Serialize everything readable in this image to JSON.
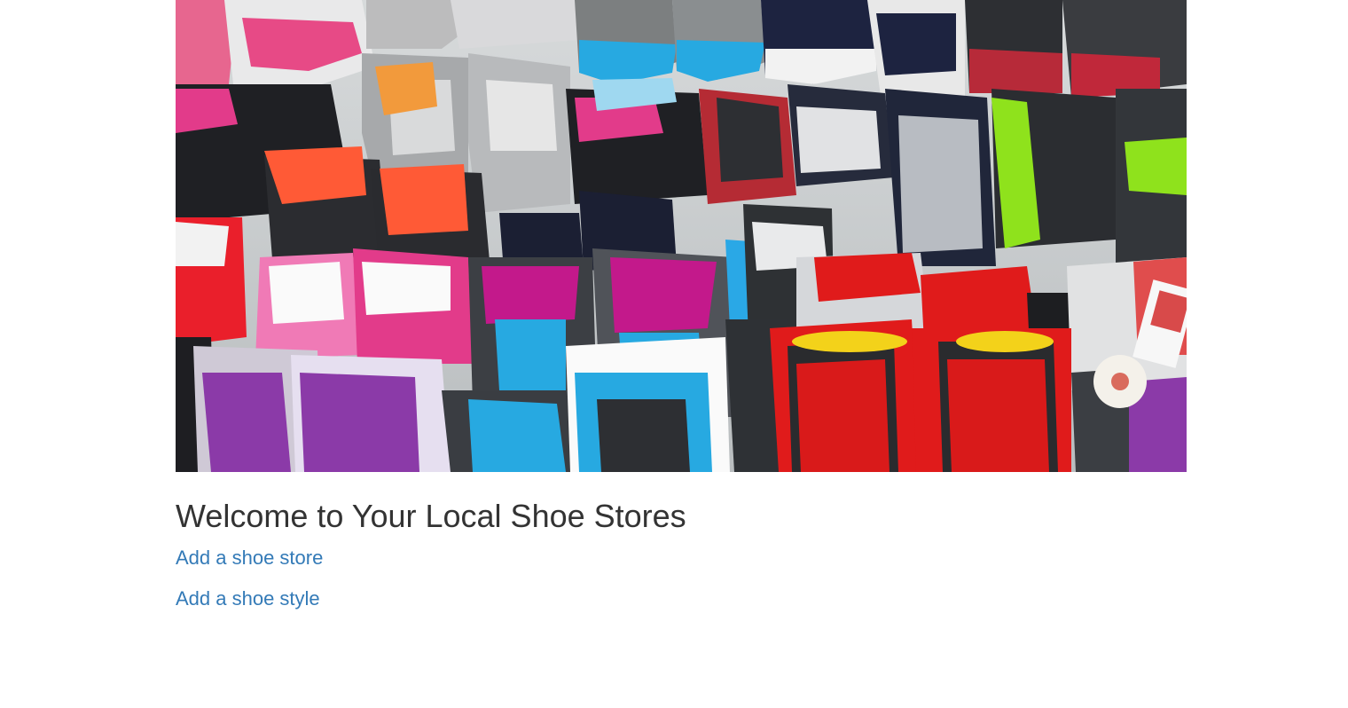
{
  "hero": {
    "alt": "Shoes on display",
    "palette": {
      "pink": "#e23b8a",
      "magenta": "#c3198b",
      "red": "#e01b1b",
      "orange": "#ff5a36",
      "sky": "#27a9e1",
      "navy": "#1d2340",
      "lime": "#8fe21c",
      "gray": "#9aa0a4",
      "charcoal": "#2d2f33",
      "purple": "#8b3aa8",
      "yellow": "#f3d21a",
      "white": "#f2f2f2"
    }
  },
  "main": {
    "title": "Welcome to Your Local Shoe Stores",
    "links": [
      {
        "label": "Add a shoe store"
      },
      {
        "label": "Add a shoe style"
      }
    ]
  }
}
